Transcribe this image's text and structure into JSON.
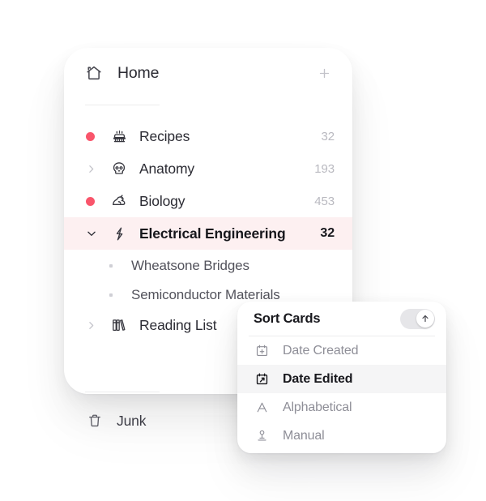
{
  "sidebar": {
    "header": {
      "icon": "home-icon",
      "label": "Home",
      "add_button_icon": "plus-icon"
    },
    "items": [
      {
        "label": "Recipes",
        "count": "32",
        "icon": "cake-icon",
        "marker": "dot",
        "marker_color": "#f9556b",
        "active": false,
        "expanded": false
      },
      {
        "label": "Anatomy",
        "count": "193",
        "icon": "skull-icon",
        "marker": "chevron-right",
        "active": false,
        "expanded": false
      },
      {
        "label": "Biology",
        "count": "453",
        "icon": "frog-icon",
        "marker": "dot",
        "marker_color": "#f9556b",
        "active": false,
        "expanded": false
      },
      {
        "label": "Electrical Engineering",
        "count": "32",
        "icon": "lightning-icon",
        "marker": "chevron-down",
        "active": true,
        "expanded": true,
        "highlight_color": "#fdf0f1"
      },
      {
        "label": "Reading List",
        "count": "",
        "icon": "books-icon",
        "marker": "chevron-right",
        "active": false,
        "expanded": false
      }
    ],
    "sub_items": [
      {
        "label": "Wheatsone Bridges"
      },
      {
        "label": "Semiconductor Materials"
      }
    ],
    "junk": {
      "label": "Junk",
      "icon": "trash-icon"
    }
  },
  "sort_panel": {
    "title": "Sort Cards",
    "toggle": {
      "icon": "arrow-up-icon",
      "state": "on",
      "track_color": "#e6e6e9"
    },
    "options": [
      {
        "label": "Date Created",
        "icon": "calendar-plus-icon",
        "selected": false
      },
      {
        "label": "Date Edited",
        "icon": "calendar-edit-icon",
        "selected": true
      },
      {
        "label": "Alphabetical",
        "icon": "letter-a-icon",
        "selected": false
      },
      {
        "label": "Manual",
        "icon": "manual-hand-icon",
        "selected": false
      }
    ]
  }
}
